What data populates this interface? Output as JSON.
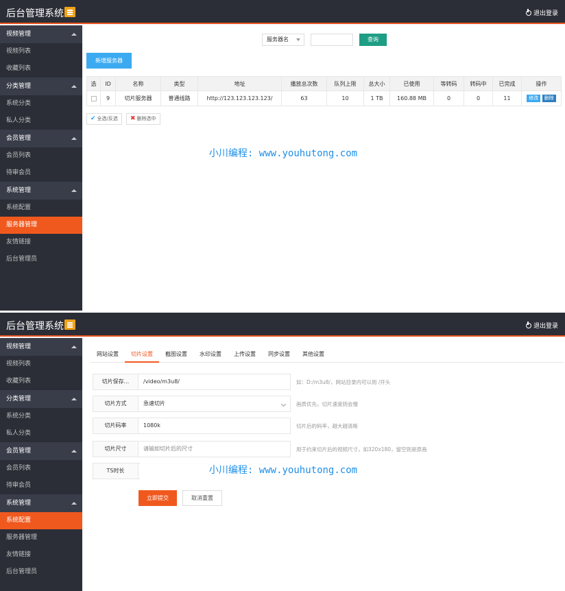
{
  "app": {
    "title": "后台管理系统",
    "logout": "退出登录"
  },
  "sidebar": {
    "groups": [
      {
        "label": "视频管理",
        "items": [
          "视频列表",
          "收藏列表"
        ]
      },
      {
        "label": "分类管理",
        "items": [
          "系统分类",
          "私人分类"
        ]
      },
      {
        "label": "会员管理",
        "items": [
          "会员列表",
          "待审会员"
        ]
      },
      {
        "label": "系统管理",
        "items": [
          "系统配置",
          "服务器管理",
          "友情链接",
          "后台管理员"
        ]
      }
    ]
  },
  "panel1": {
    "active_item": "服务器管理",
    "search": {
      "select_value": "服务器名",
      "query_button": "查询"
    },
    "add_button": "新增服务器",
    "table": {
      "headers": [
        "选",
        "ID",
        "名称",
        "类型",
        "地址",
        "播放总次数",
        "队列上限",
        "总大小",
        "已使用",
        "等转码",
        "转码中",
        "已完成",
        "操作"
      ],
      "rows": [
        {
          "id": "9",
          "name": "切片服务器",
          "type": "普通线路",
          "address": "http://123.123.123.123/",
          "plays": "63",
          "queue": "10",
          "total": "1 TB",
          "used": "160.88 MB",
          "waiting": "0",
          "converting": "0",
          "done": "11",
          "edit": "修改",
          "delete": "删除"
        }
      ]
    },
    "select_all": "全选/反选",
    "delete_selected": "删除选中",
    "watermark": "小川编程: www.youhutong.com"
  },
  "panel2": {
    "active_item": "系统配置",
    "tabs": [
      "网站设置",
      "切片设置",
      "截图设置",
      "水印设置",
      "上传设置",
      "同步设置",
      "其他设置"
    ],
    "active_tab": "切片设置",
    "form": [
      {
        "label": "切片保存...",
        "value": "/video/m3u8/",
        "hint": "如：D:/m3u8/，网站目录内可以用 /开头"
      },
      {
        "label": "切片方式",
        "value": "急速切片",
        "hint": "画质优先，切片速度则会慢"
      },
      {
        "label": "切片码率",
        "value": "1080k",
        "hint": "切片后的码率，越大越清晰"
      },
      {
        "label": "切片尺寸",
        "placeholder": "请输如切片后的尺寸",
        "hint": "用于约束切片后的视频尺寸，如320x180，留空则是原画"
      },
      {
        "label": "TS时长",
        "value": "",
        "hint": ""
      }
    ],
    "submit": "立即提交",
    "reset": "取消重置",
    "watermark": "小川编程: www.youhutong.com"
  },
  "colors": {
    "accent": "#f0591e",
    "sidebar": "#2b2e37",
    "teal": "#1e9e84",
    "blue": "#3caaf0"
  }
}
